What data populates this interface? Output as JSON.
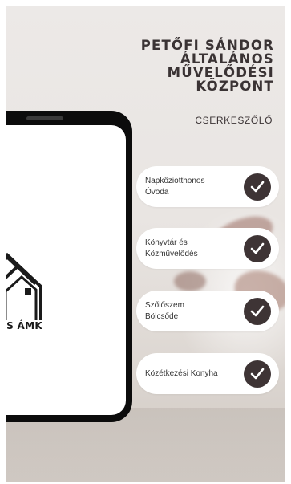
{
  "header": {
    "title_lines": [
      "PETŐFI SÁNDOR",
      "ÁLTALÁNOS",
      "MŰVELŐDÉSI",
      "KÖZPONT"
    ],
    "subtitle": "CSERKESZŐLŐ"
  },
  "phone": {
    "logo_text": "PS ÁMK",
    "logo_icon": "house-icon"
  },
  "services": [
    {
      "lines": [
        "Napköziotthonos",
        "Óvoda"
      ],
      "icon": "check-icon"
    },
    {
      "lines": [
        "Könyvtár és",
        "Közművelődés"
      ],
      "icon": "check-icon"
    },
    {
      "lines": [
        "Szőlőszem",
        "Bölcsőde"
      ],
      "icon": "check-icon"
    },
    {
      "lines": [
        "Közétkezési Konyha"
      ],
      "icon": "check-icon"
    }
  ],
  "colors": {
    "accent": "#3e3435",
    "background": "#e9e5e2",
    "text": "#3a3334"
  }
}
